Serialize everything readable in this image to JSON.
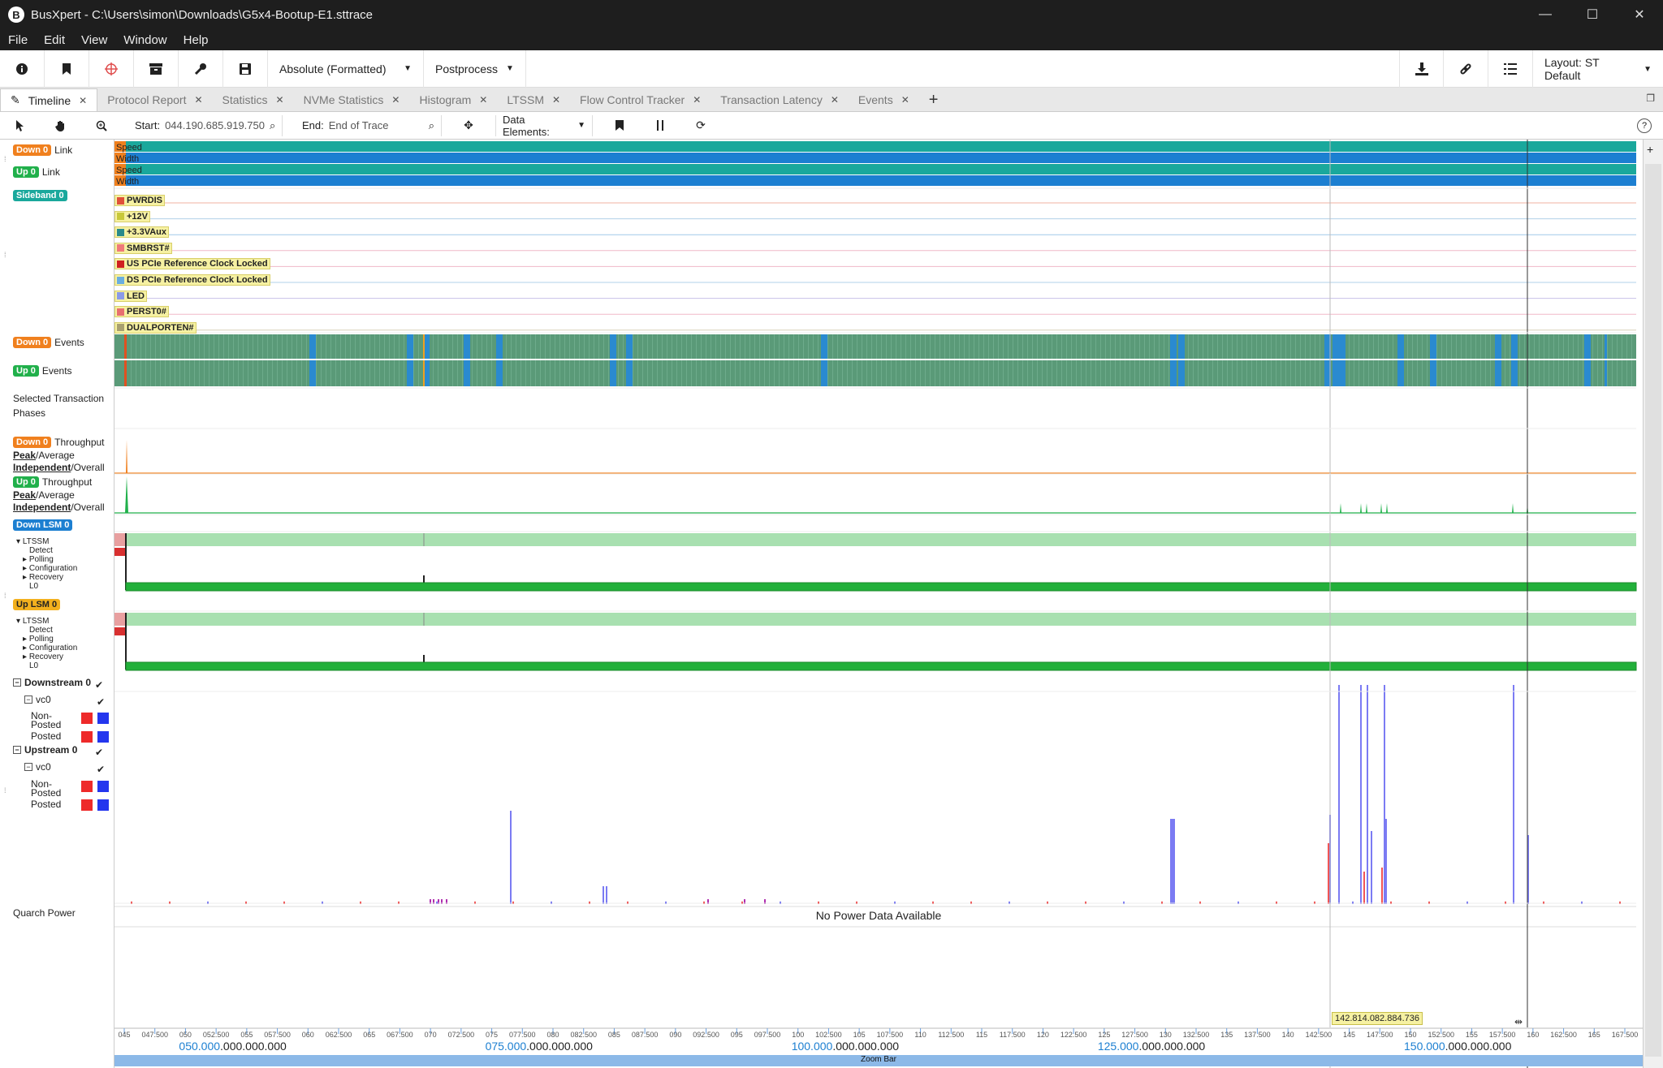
{
  "app": {
    "logo_letter": "B",
    "title": "BusXpert - C:\\Users\\simon\\Downloads\\G5x4-Bootup-E1.sttrace",
    "win_buttons": [
      "—",
      "☐",
      "✕"
    ]
  },
  "menu": [
    "File",
    "Edit",
    "View",
    "Window",
    "Help"
  ],
  "toolbar": {
    "time_format": "Absolute (Formatted)",
    "postprocess": "Postprocess",
    "layout": "Layout: ST Default"
  },
  "tabs": [
    {
      "label": "Timeline",
      "active": true
    },
    {
      "label": "Protocol Report"
    },
    {
      "label": "Statistics"
    },
    {
      "label": "NVMe Statistics"
    },
    {
      "label": "Histogram"
    },
    {
      "label": "LTSSM"
    },
    {
      "label": "Flow Control Tracker"
    },
    {
      "label": "Transaction Latency"
    },
    {
      "label": "Events"
    }
  ],
  "tab_add": "+",
  "timeline_toolbar": {
    "start_label": "Start:",
    "start_value": "044.190.685.919.750",
    "end_label": "End:",
    "end_value": "End of Trace",
    "data_elements": "Data Elements:",
    "help": "?"
  },
  "rows": {
    "down0": "Down 0",
    "up0": "Up 0",
    "link": "Link",
    "sideband0": "Sideband 0",
    "events": "Events",
    "selected_transaction": "Selected Transaction",
    "phases": "Phases",
    "throughput": "Throughput",
    "peak": "Peak",
    "average": "/Average",
    "independent": "Independent",
    "overall": "/Overall",
    "down_lsm": "Down LSM 0",
    "up_lsm": "Up LSM 0",
    "ltssm_states": [
      "LTSSM",
      "Detect",
      "Polling",
      "Configuration",
      "Recovery",
      "L0"
    ],
    "downstream0": "Downstream 0",
    "upstream0": "Upstream 0",
    "vc0": "vc0",
    "non_posted": "Non-Posted",
    "posted": "Posted",
    "quarch_power": "Quarch Power"
  },
  "link_bars": [
    "Speed",
    "Width",
    "Speed",
    "Width"
  ],
  "sideband_signals": [
    {
      "name": "PWRDIS",
      "color": "#e0503a",
      "line": "#f0b0a0"
    },
    {
      "name": "+12V",
      "color": "#c8c83a",
      "line": "#b0d0e8"
    },
    {
      "name": "+3.3VAux",
      "color": "#2a8a8a",
      "line": "#a0c8e8"
    },
    {
      "name": "SMBRST#",
      "color": "#f07a7a",
      "line": "#f0b8c8"
    },
    {
      "name": "US PCIe Reference Clock Locked",
      "color": "#d02020",
      "line": "#f0b8c8"
    },
    {
      "name": "DS PCIe Reference Clock Locked",
      "color": "#6aaee0",
      "line": "#b0d0e8"
    },
    {
      "name": "LED",
      "color": "#8a9ae8",
      "line": "#c8c0e8"
    },
    {
      "name": "PERST0#",
      "color": "#e87070",
      "line": "#f0b8c8"
    },
    {
      "name": "DUALPORTEN#",
      "color": "#a8a070",
      "line": "#d8d0b8"
    }
  ],
  "no_power": "No Power Data Available",
  "cursor_time": "142.814.082.884.736",
  "axis": {
    "minor": [
      "045",
      "047.500",
      "050",
      "052.500",
      "055",
      "057.500",
      "060",
      "062.500",
      "065",
      "067.500",
      "070",
      "072.500",
      "075",
      "077.500",
      "080",
      "082.500",
      "085",
      "087.500",
      "090",
      "092.500",
      "095",
      "097.500",
      "100",
      "102.500",
      "105",
      "107.500",
      "110",
      "112.500",
      "115",
      "117.500",
      "120",
      "122.500",
      "125",
      "127.500",
      "130",
      "132.500",
      "135",
      "137.500",
      "140",
      "142.500",
      "145",
      "147.500",
      "150",
      "152.500",
      "155",
      "157.500",
      "160",
      "162.500",
      "165",
      "167.500"
    ],
    "major": [
      {
        "blue": "050.000",
        "rest": ".000.000.000"
      },
      {
        "blue": "075.000",
        "rest": ".000.000.000"
      },
      {
        "blue": "100.000",
        "rest": ".000.000.000"
      },
      {
        "blue": "125.000",
        "rest": ".000.000.000"
      },
      {
        "blue": "150.000",
        "rest": ".000.000.000"
      }
    ],
    "zoom_bar": "Zoom Bar"
  },
  "colors": {
    "down": "#f0801e",
    "up": "#21b04b",
    "speed": "#1aa89c",
    "width": "#1c7fd1",
    "events_green": "#5a9a78",
    "events_blue": "#2a8ad0",
    "ltssm_light": "#a8e0b0",
    "ltssm_dark": "#22b03a",
    "nonposted": "#ee2a2a",
    "posted": "#5a5af0"
  }
}
